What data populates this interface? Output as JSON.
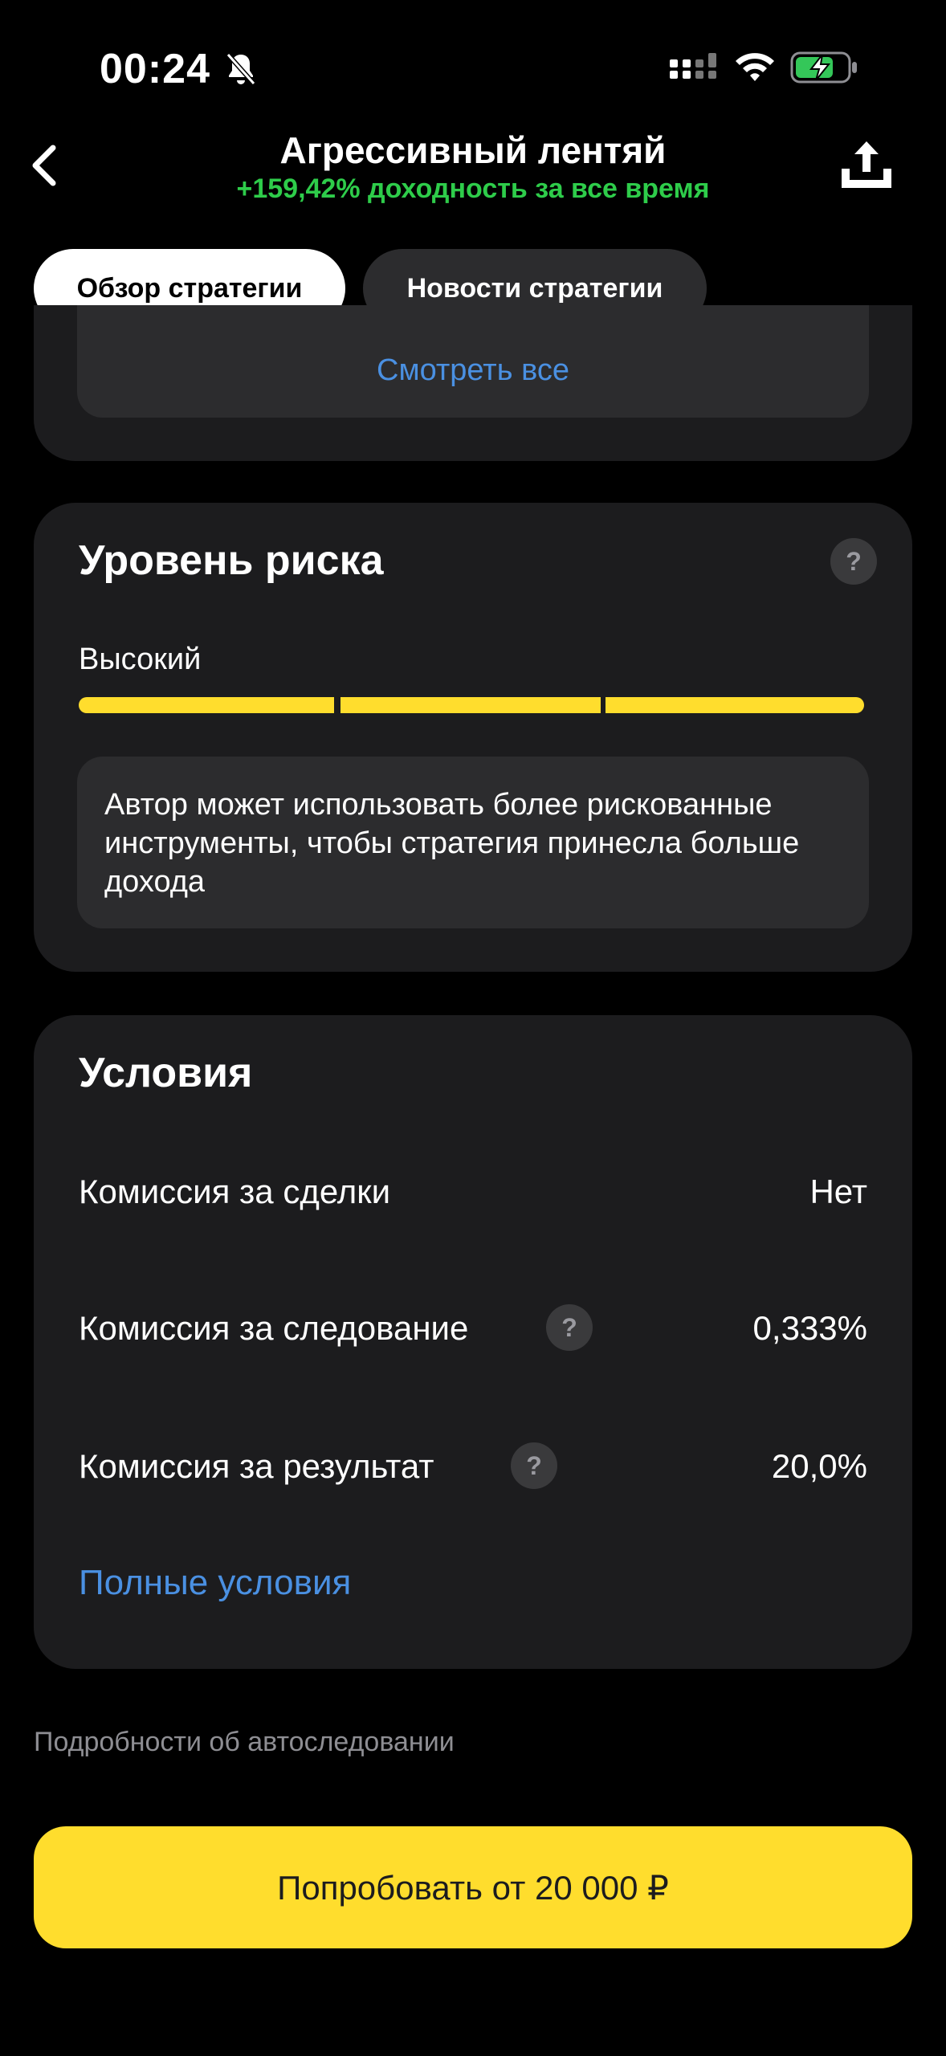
{
  "status_bar": {
    "time": "00:24"
  },
  "header": {
    "title": "Агрессивный лентяй",
    "subtitle": "+159,42% доходность за все время"
  },
  "tabs": [
    {
      "label": "Обзор стратегии",
      "active": true
    },
    {
      "label": "Новости стратегии",
      "active": false
    }
  ],
  "top_card": {
    "see_all": "Смотреть все"
  },
  "risk": {
    "title": "Уровень риска",
    "help": "?",
    "level": "Высокий",
    "filled_segments": 3,
    "total_segments": 3,
    "description": "Автор может использовать более рискованные инструменты, чтобы стратегия принесла больше дохода",
    "bar_color": "#ffdd2d"
  },
  "conditions": {
    "title": "Условия",
    "rows": [
      {
        "label": "Комиссия за сделки",
        "value": "Нет"
      },
      {
        "label": "Комиссия за следование",
        "value": "0,333%",
        "help": "?"
      },
      {
        "label": "Комиссия за результат",
        "value": "20,0%",
        "help": "?"
      }
    ],
    "full_link": "Полные условия"
  },
  "details_link": "Подробности об автоследовании",
  "cta": {
    "label": "Попробовать от 20 000 ₽"
  },
  "colors": {
    "accent": "#ffdd2d",
    "link": "#4a90e2",
    "positive": "#2ecc4a",
    "card": "#1c1c1e"
  }
}
